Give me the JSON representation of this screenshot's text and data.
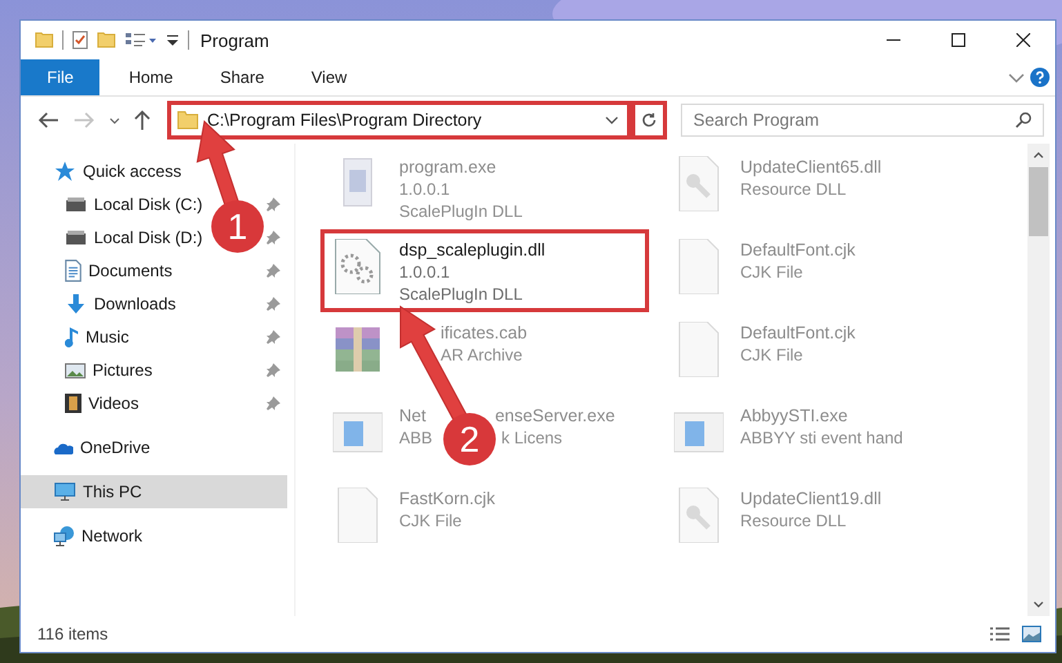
{
  "window": {
    "title": "Program"
  },
  "ribbon_tabs": [
    {
      "label": "File",
      "selected": true
    },
    {
      "label": "Home",
      "selected": false
    },
    {
      "label": "Share",
      "selected": false
    },
    {
      "label": "View",
      "selected": false
    }
  ],
  "address": {
    "value": "C:\\Program Files\\Program Directory",
    "highlighted": true
  },
  "search": {
    "placeholder": "Search Program"
  },
  "sidebar": {
    "items": [
      {
        "label": "Quick access",
        "kind": "star",
        "selected": false,
        "children": [
          {
            "label": "Local Disk (C:)",
            "kind": "disk",
            "pinned": true,
            "selected": false
          },
          {
            "label": "Local Disk (D:)",
            "kind": "disk",
            "pinned": true,
            "selected": false
          },
          {
            "label": "Documents",
            "kind": "doc",
            "pinned": true,
            "selected": false
          },
          {
            "label": "Downloads",
            "kind": "download",
            "pinned": true,
            "selected": false
          },
          {
            "label": "Music",
            "kind": "music",
            "pinned": true,
            "selected": false
          },
          {
            "label": "Pictures",
            "kind": "pictures",
            "pinned": true,
            "selected": false
          },
          {
            "label": "Videos",
            "kind": "videos",
            "pinned": true,
            "selected": false
          }
        ]
      },
      {
        "label": "OneDrive",
        "kind": "cloud",
        "selected": false
      },
      {
        "label": "This PC",
        "kind": "pc",
        "selected": true
      },
      {
        "label": "Network",
        "kind": "network",
        "selected": false
      }
    ]
  },
  "files": [
    {
      "name": [
        "program.exe"
      ],
      "lines": [
        [
          "1.0.0.1"
        ],
        [
          "ScalePlugIn DLL"
        ]
      ],
      "kind": "installer",
      "faded": true,
      "highlighted": false
    },
    {
      "name": [
        "UpdateClient65.dll"
      ],
      "lines": [
        [
          "Resource DLL"
        ]
      ],
      "kind": "dll",
      "faded": true,
      "highlighted": false
    },
    {
      "name": [
        "dsp_scaleplugin.dll"
      ],
      "lines": [
        [
          "1.0.0.1"
        ],
        [
          "ScalePlugIn DLL"
        ]
      ],
      "kind": "gears",
      "faded": false,
      "highlighted": true
    },
    {
      "name": [
        "DefaultFont.cjk"
      ],
      "lines": [
        [
          "CJK File"
        ]
      ],
      "kind": "blank",
      "faded": true,
      "highlighted": false
    },
    {
      "name": [
        "ificates.cab"
      ],
      "lines": [
        [
          "AR Archive"
        ]
      ],
      "kind": "archive",
      "faded": true,
      "highlighted": false
    },
    {
      "name": [
        "DefaultFont.cjk"
      ],
      "lines": [
        [
          "CJK File"
        ]
      ],
      "kind": "blank",
      "faded": true,
      "highlighted": false
    },
    {
      "name": [
        "Net",
        "enseServer.exe"
      ],
      "lines": [
        [
          "ABB",
          "k Licens"
        ]
      ],
      "kind": "app",
      "faded": true,
      "highlighted": false
    },
    {
      "name": [
        "AbbyySTI.exe"
      ],
      "lines": [
        [
          "ABBYY sti event hand"
        ]
      ],
      "kind": "app",
      "faded": true,
      "highlighted": false
    },
    {
      "name": [
        "FastKorn.cjk"
      ],
      "lines": [
        [
          "CJK File"
        ]
      ],
      "kind": "blank",
      "faded": true,
      "highlighted": false
    },
    {
      "name": [
        "UpdateClient19.dll"
      ],
      "lines": [
        [
          "Resource DLL"
        ]
      ],
      "kind": "dll",
      "faded": true,
      "highlighted": false
    }
  ],
  "status_bar": {
    "count": "116 items"
  },
  "annotations": [
    {
      "label": "1"
    },
    {
      "label": "2"
    }
  ]
}
